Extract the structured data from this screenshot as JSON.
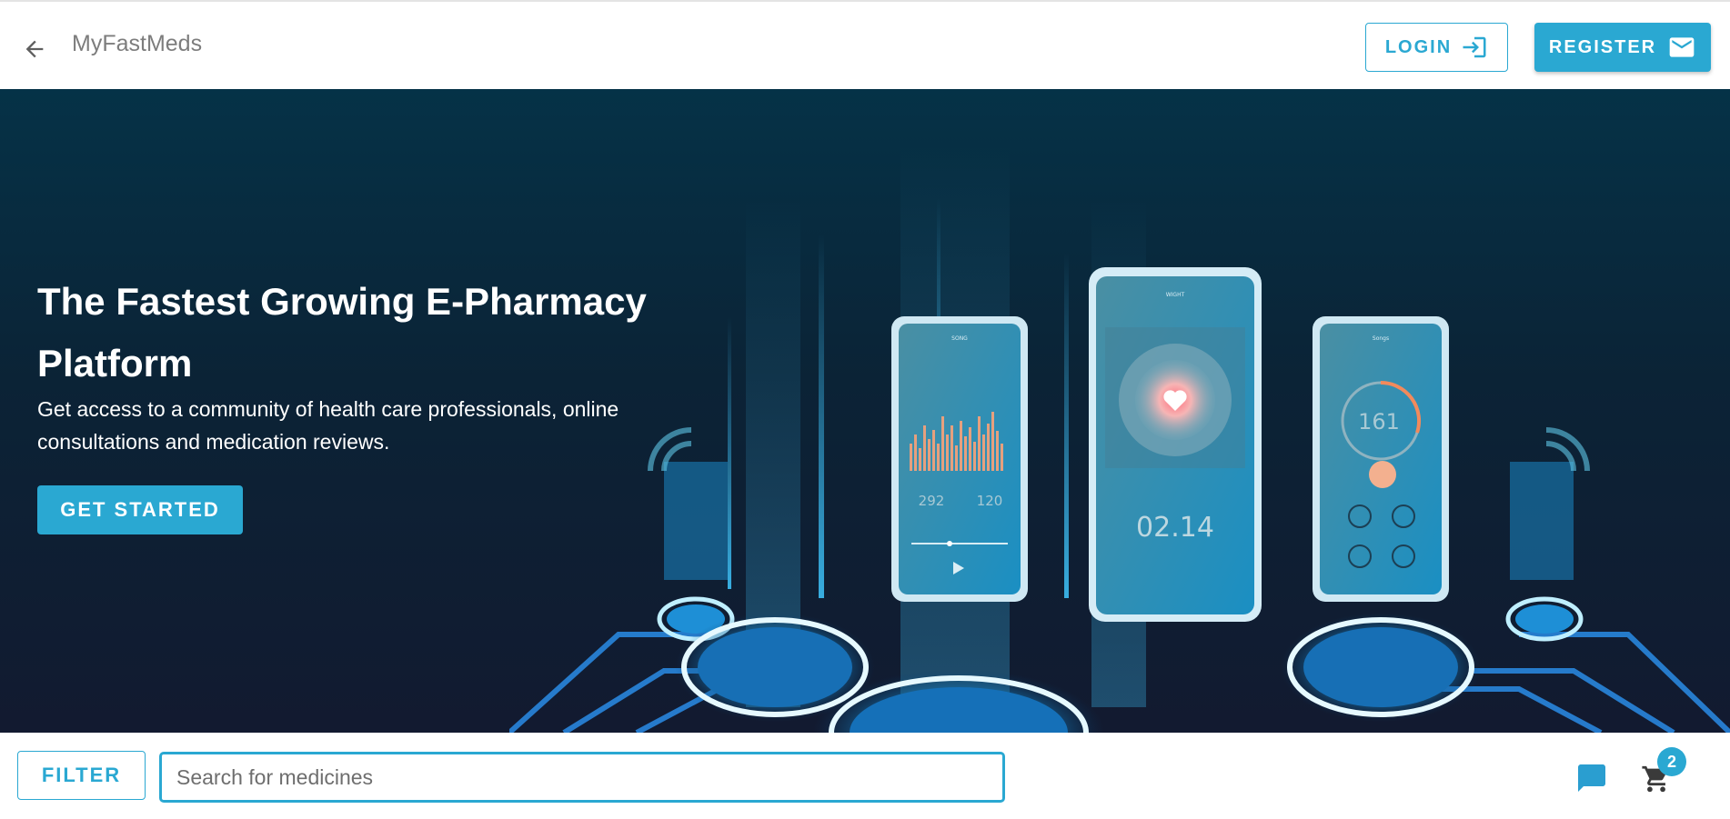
{
  "header": {
    "title": "MyFastMeds",
    "login_label": "LOGIN",
    "register_label": "REGISTER"
  },
  "hero": {
    "title": "The Fastest Growing E-Pharmacy Platform",
    "subtitle": "Get access to a community of health care professionals, online consultations and medication reviews.",
    "cta_label": "GET STARTED",
    "phone_left": {
      "screen_title": "SONG",
      "stat_1": "292",
      "stat_2": "120"
    },
    "phone_center": {
      "screen_title": "WIGHT",
      "time": "02.14"
    },
    "phone_right": {
      "screen_title": "Songs",
      "reading": "161"
    }
  },
  "toolbar": {
    "filter_label": "FILTER",
    "search_placeholder": "Search for medicines",
    "search_value": "",
    "cart_count": "2"
  },
  "colors": {
    "accent": "#2aa8d2",
    "hero_top": "#053247",
    "hero_bottom": "#121a30",
    "title_gray": "#7d7d7d"
  },
  "icons": {
    "back": "arrow-left-icon",
    "login": "login-icon",
    "register": "mail-icon",
    "chat": "chat-icon",
    "cart": "cart-icon"
  }
}
